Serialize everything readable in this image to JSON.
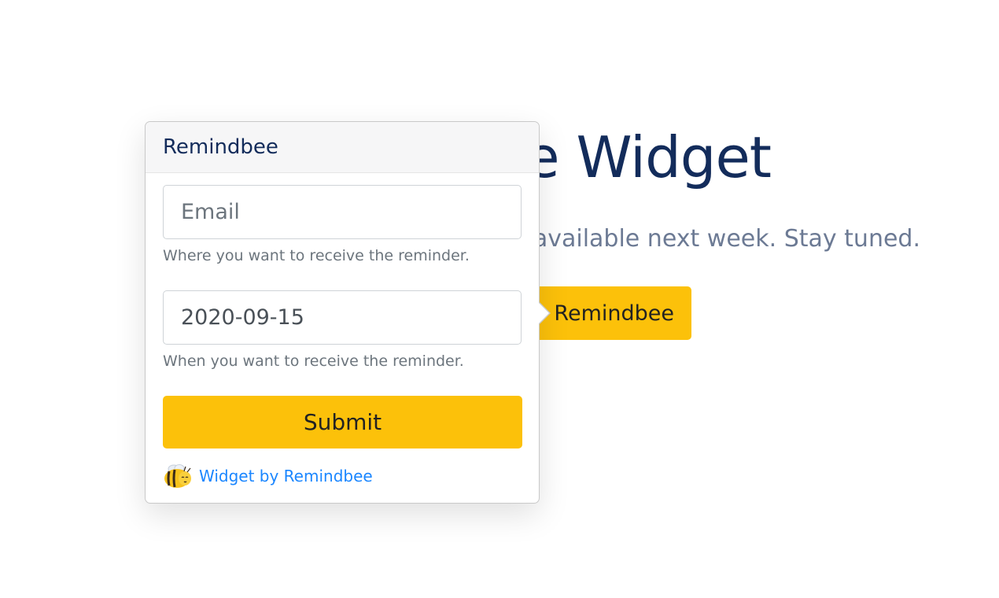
{
  "hero": {
    "title": "e Widget",
    "subtitle": "e available next week. Stay tuned.",
    "button_label": "Remindbee"
  },
  "popover": {
    "title": "Remindbee",
    "email": {
      "placeholder": "Email",
      "value": "",
      "help": "Where you want to receive the reminder."
    },
    "date": {
      "value": "2020-09-15",
      "help": "When you want to receive the reminder."
    },
    "submit_label": "Submit",
    "footer_link": "Widget by Remindbee",
    "footer_icon": "bee-icon"
  },
  "colors": {
    "accent": "#fcc10a",
    "title": "#132c5b",
    "subtitle": "#6c7a94",
    "link": "#1a86ff",
    "muted": "#6c757d"
  }
}
